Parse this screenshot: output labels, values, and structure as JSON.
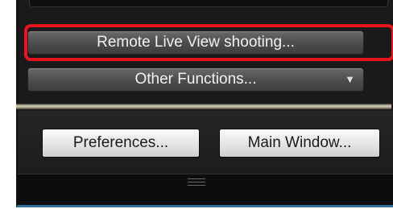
{
  "panel": {
    "remote_live_view_label": "Remote Live View shooting...",
    "other_functions_label": "Other Functions...",
    "other_functions_arrow": "▼",
    "preferences_label": "Preferences...",
    "main_window_label": "Main Window..."
  },
  "colors": {
    "highlight": "#e8141e",
    "window_bg": "#1a1a1a",
    "accent_border": "#2d6e9a"
  },
  "icons": {
    "dropdown": "chevron-down-icon",
    "resize_grip": "resize-grip-icon"
  }
}
